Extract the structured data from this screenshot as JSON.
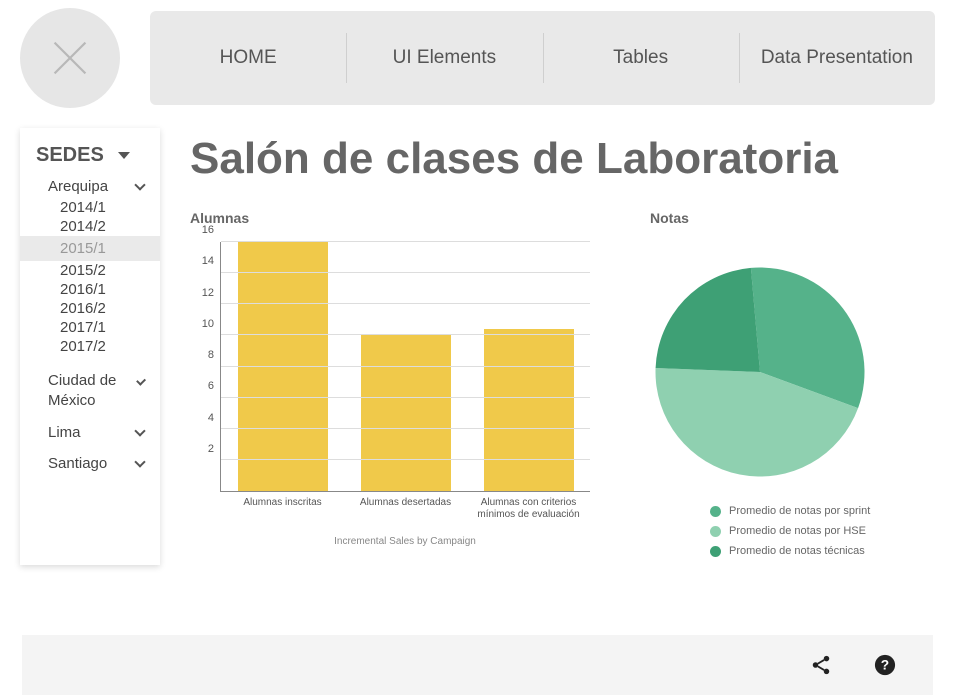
{
  "nav": {
    "items": [
      "HOME",
      "UI Elements",
      "Tables",
      "Data Presentation"
    ]
  },
  "sidebar": {
    "header": "SEDES",
    "arequipa": {
      "label": "Arequipa",
      "periods": [
        "2014/1",
        "2014/2",
        "2015/1",
        "2015/2",
        "2016/1",
        "2016/2",
        "2017/1",
        "2017/2"
      ],
      "selected": "2015/1"
    },
    "other_cities": [
      "Ciudad de México",
      "Lima",
      "Santiago"
    ]
  },
  "main": {
    "title": "Salón de clases de Laboratoria"
  },
  "bar": {
    "title": "Alumnas",
    "subtitle": "Incremental Sales by Campaign"
  },
  "pie": {
    "title": "Notas"
  },
  "chart_data": [
    {
      "type": "bar",
      "title": "Alumnas",
      "subtitle": "Incremental Sales by Campaign",
      "categories": [
        "Alumnas inscritas",
        "Alumnas desertadas",
        "Alumnas con criterios mínimos de evaluación"
      ],
      "values": [
        16,
        10,
        10.4
      ],
      "ylim": [
        0,
        16
      ],
      "yticks": [
        2,
        4,
        6,
        8,
        10,
        12,
        14,
        16
      ],
      "color": "#f0c94a"
    },
    {
      "type": "pie",
      "title": "Notas",
      "series": [
        {
          "name": "Promedio de notas por sprint",
          "value": 32,
          "color": "#55b28a"
        },
        {
          "name": "Promedio de notas por HSE",
          "value": 45,
          "color": "#8fd0b0"
        },
        {
          "name": "Promedio de notas técnicas",
          "value": 23,
          "color": "#3ea075"
        }
      ]
    }
  ]
}
